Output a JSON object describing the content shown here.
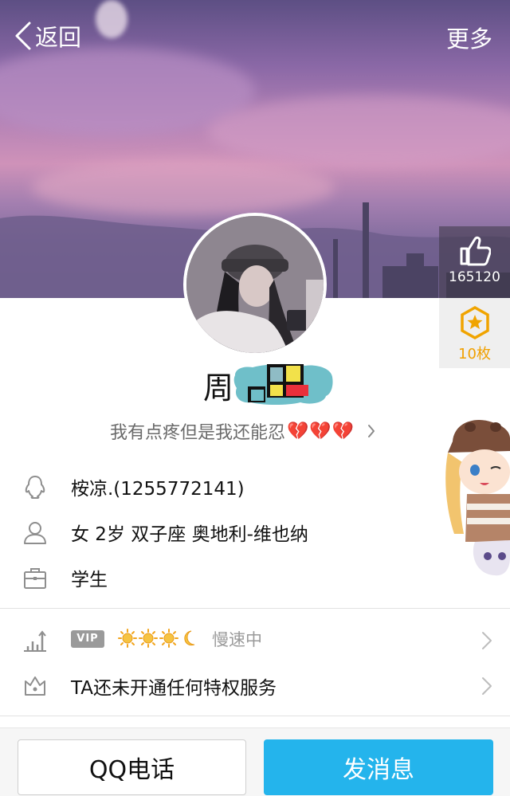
{
  "header": {
    "back_label": "返回",
    "more_label": "更多"
  },
  "likes": {
    "count": "165120",
    "icon": "thumbs-up-icon"
  },
  "medals": {
    "count": "10枚",
    "icon": "medal-icon"
  },
  "profile": {
    "name": "周",
    "signature": "我有点疼但是我还能忍",
    "signature_emoji": "💔💔💔"
  },
  "info": {
    "qq": "桉凉.(1255772141)",
    "details": "女  2岁  双子座  奥地利-维也纳",
    "occupation": "学生"
  },
  "privileges": {
    "vip_badge": "VIP",
    "speed": "慢速中",
    "service_text": "TA还未开通任何特权服务"
  },
  "actions": {
    "call_label": "QQ电话",
    "message_label": "发消息"
  },
  "colors": {
    "accent": "#24b4ec",
    "medal": "#f0a400"
  }
}
